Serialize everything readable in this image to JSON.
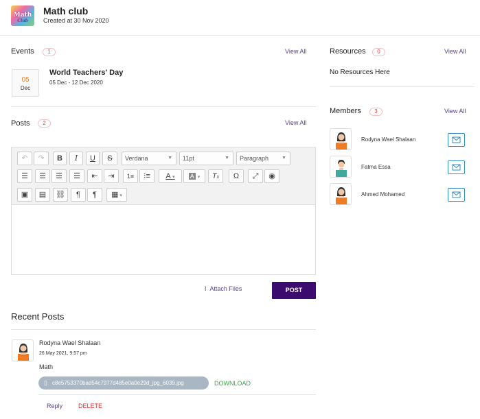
{
  "club": {
    "logo_text": "Math",
    "logo_subtext": "Club",
    "title": "Math club",
    "created": "Created at 30 Nov 2020"
  },
  "events": {
    "title": "Events",
    "count": "1",
    "view_all": "View All",
    "items": [
      {
        "day": "05",
        "month": "Dec",
        "title": "World Teachers' Day",
        "range": "05 Dec - 12 Dec 2020"
      }
    ]
  },
  "posts": {
    "title": "Posts",
    "count": "2",
    "view_all": "View All"
  },
  "editor": {
    "font_family": "Verdana",
    "font_size": "11pt",
    "block_format": "Paragraph"
  },
  "composer": {
    "attach_label": "Attach Files",
    "post_label": "POST"
  },
  "recent": {
    "title": "Recent Posts",
    "items": [
      {
        "author": "Rodyna Wael Shalaan",
        "date": "26 May 2021, 9:57 pm",
        "text": "Math",
        "file": "c8e5753370bad54c7977d485e0a0e29d_jpg_6039.jpg",
        "download": "DOWNLOAD",
        "reply": "Reply",
        "delete": "DELETE"
      }
    ]
  },
  "resources": {
    "title": "Resources",
    "count": "0",
    "view_all": "View All",
    "empty": "No Resources Here"
  },
  "members": {
    "title": "Members",
    "count": "3",
    "view_all": "View All",
    "items": [
      {
        "name": "Rodyna Wael Shalaan",
        "avatar": "female"
      },
      {
        "name": "Fatma Essa",
        "avatar": "male"
      },
      {
        "name": "Ahmed Mohamed",
        "avatar": "female"
      }
    ]
  },
  "colors": {
    "accent": "#3b0c6e",
    "link": "#5b3f8f",
    "count_badge": "#e0433f",
    "download": "#3aa844",
    "delete": "#e02b2b",
    "mail": "#2a8ccc"
  }
}
